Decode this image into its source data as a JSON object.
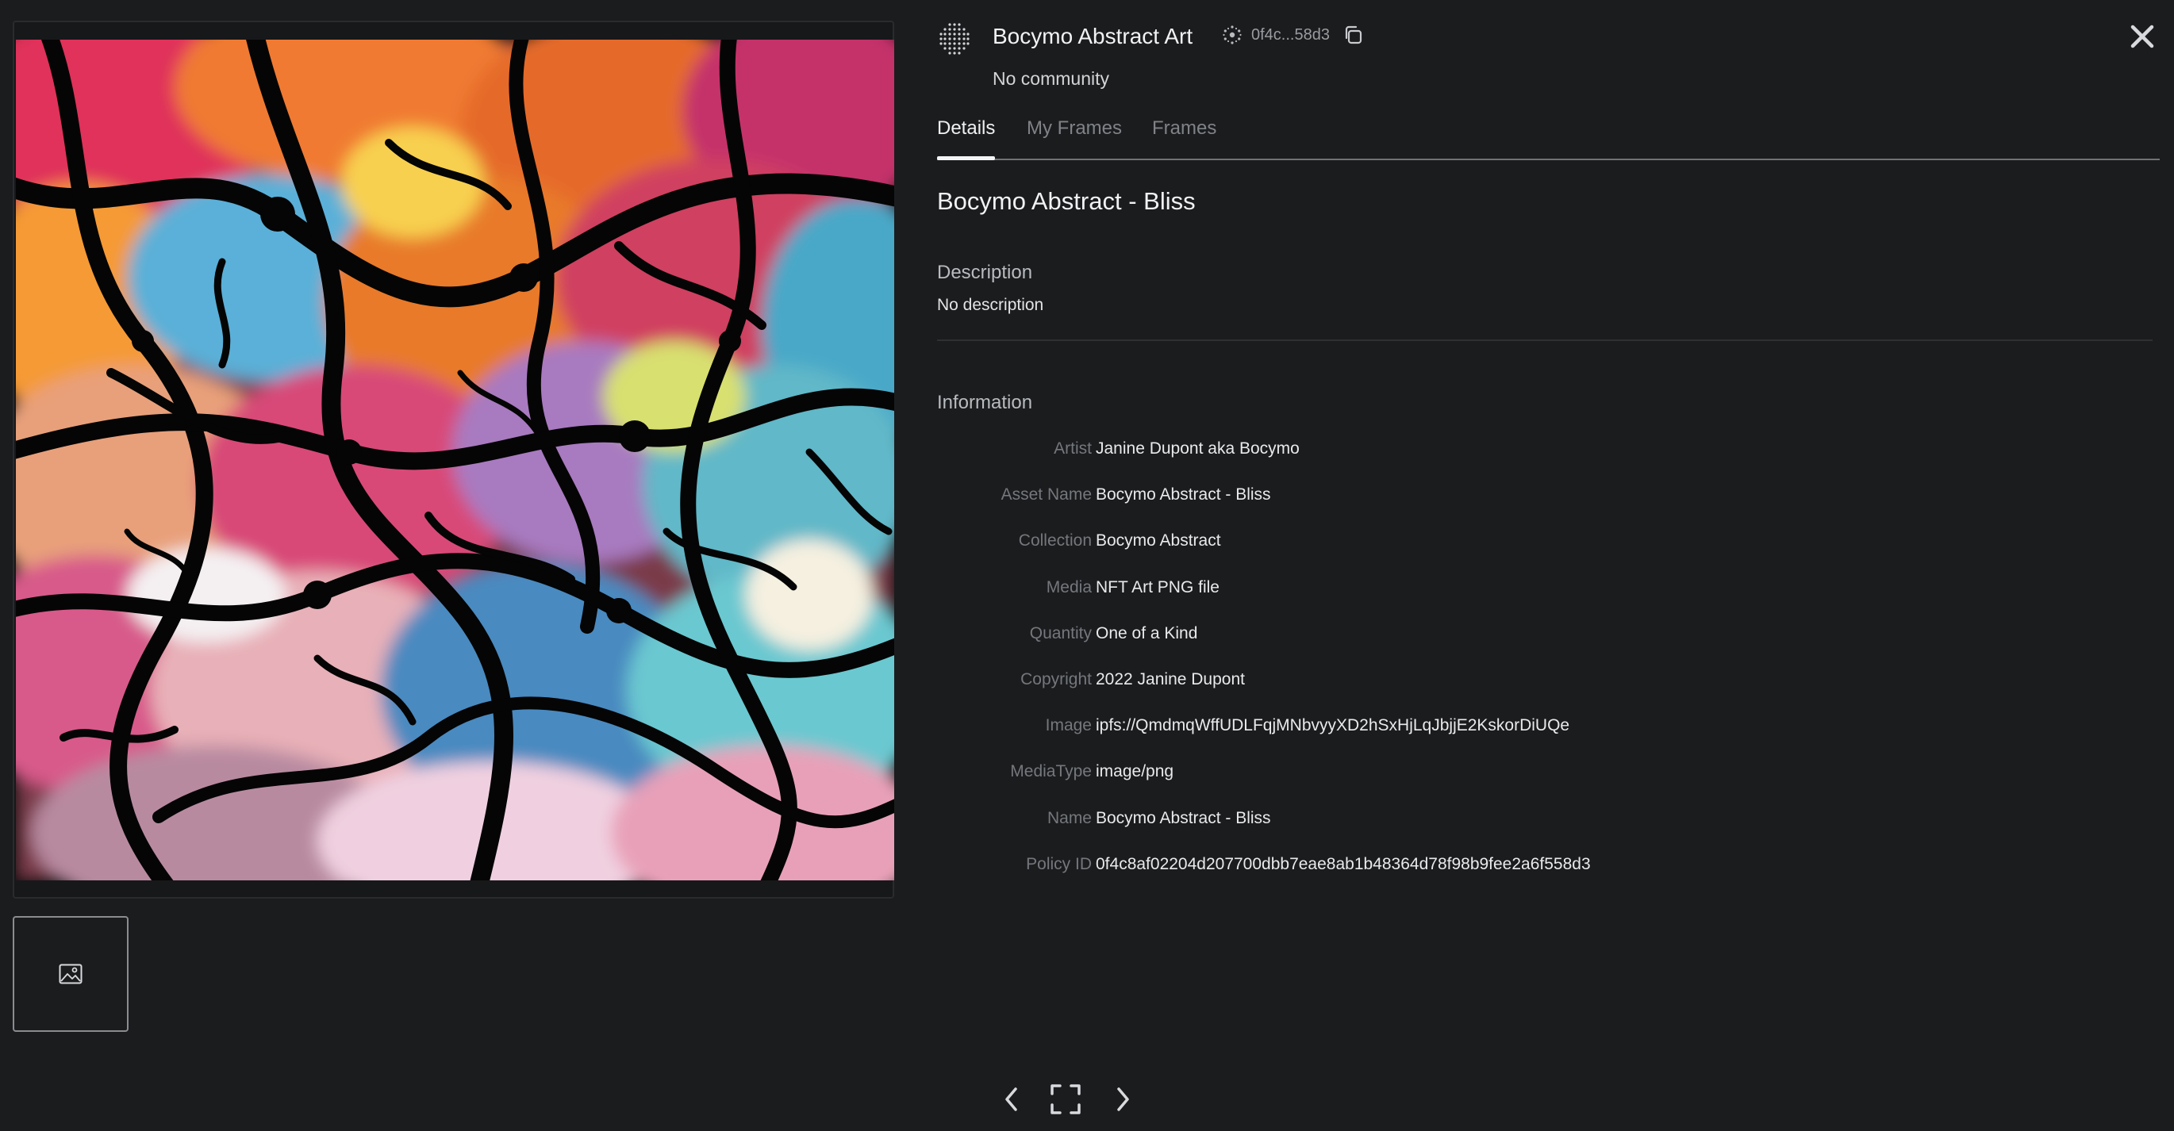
{
  "header": {
    "collection_name": "Bocymo Abstract Art",
    "policy_short": "0f4c...58d3",
    "community": "No community",
    "logo_icon": "dot-grid-logo",
    "policy_icon": "cardano-icon",
    "copy_icon": "copy-icon",
    "close_icon": "close-icon"
  },
  "tabs": [
    {
      "label": "Details",
      "active": true
    },
    {
      "label": "My Frames",
      "active": false
    },
    {
      "label": "Frames",
      "active": false
    }
  ],
  "asset": {
    "title": "Bocymo Abstract - Bliss",
    "description_heading": "Description",
    "description": "No description",
    "information_heading": "Information",
    "information": [
      {
        "key": "Artist",
        "value": "Janine Dupont aka Bocymo"
      },
      {
        "key": "Asset Name",
        "value": "Bocymo Abstract - Bliss"
      },
      {
        "key": "Collection",
        "value": "Bocymo Abstract"
      },
      {
        "key": "Media",
        "value": "NFT Art PNG file"
      },
      {
        "key": "Quantity",
        "value": "One of a Kind"
      },
      {
        "key": "Copyright",
        "value": "2022 Janine Dupont"
      },
      {
        "key": "Image",
        "value": "ipfs://QmdmqWffUDLFqjMNbvyyXD2hSxHjLqJbjjE2KskorDiUQe"
      },
      {
        "key": "MediaType",
        "value": "image/png"
      },
      {
        "key": "Name",
        "value": "Bocymo Abstract - Bliss"
      },
      {
        "key": "Policy ID",
        "value": "0f4c8af02204d207700dbb7eae8ab1b48364d78f98b9fee2a6f558d3"
      }
    ]
  },
  "media": {
    "artwork": "abstract-painting",
    "thumbnail_icon": "image-icon"
  },
  "controls": {
    "prev_icon": "chevron-left-icon",
    "fullscreen_icon": "fullscreen-icon",
    "next_icon": "chevron-right-icon"
  },
  "colors": {
    "background": "#1b1c1e",
    "text_primary": "#f1f2f3",
    "text_muted": "#74777c",
    "tab_inactive": "#7f8287",
    "divider": "#2e3034"
  }
}
